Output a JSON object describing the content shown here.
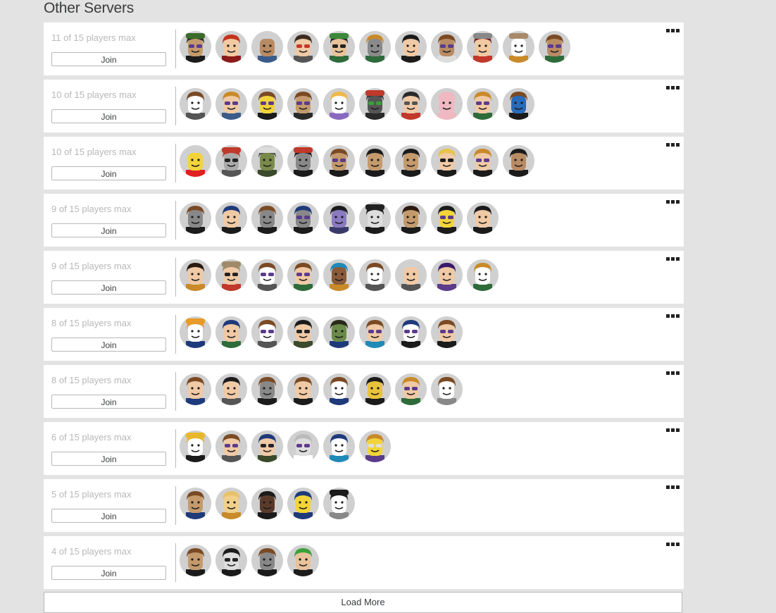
{
  "section": {
    "title": "Other Servers"
  },
  "join_label": "Join",
  "load_more_label": "Load More",
  "servers": [
    {
      "players_text": "11 of 15 players max",
      "avatars": [
        {
          "skin": "#c49a6c",
          "hair": "#2a2a2a",
          "shirt": "#1b1b1b",
          "hat": "#3a6b2a",
          "glasses": "#5b3b8a"
        },
        {
          "skin": "#f2c9a0",
          "hair": "#c2331f",
          "shirt": "#8b1a1a",
          "hat": "",
          "glasses": ""
        },
        {
          "skin": "#b98b64",
          "hair": "",
          "shirt": "#3b5b8a",
          "hat": "",
          "glasses": ""
        },
        {
          "skin": "#f0c9a5",
          "hair": "#3b2a1e",
          "shirt": "#555555",
          "hat": "",
          "glasses": "#c0392b"
        },
        {
          "skin": "#e8c29a",
          "hair": "#2a2a2a",
          "shirt": "#2e6b3a",
          "hat": "#3a8a3a",
          "glasses": "#222222"
        },
        {
          "skin": "#8a8a8a",
          "hair": "#c98a2a",
          "shirt": "#2e6b3a",
          "hat": "",
          "glasses": ""
        },
        {
          "skin": "#f0c9a5",
          "hair": "#1b1b1b",
          "shirt": "#1b1b1b",
          "hat": "",
          "glasses": ""
        },
        {
          "skin": "#b98b64",
          "hair": "#7a4a24",
          "shirt": "#dddddd",
          "hat": "",
          "glasses": "#5b3b8a"
        },
        {
          "skin": "#f2c9a0",
          "hair": "#7a1a1a",
          "shirt": "#c0392b",
          "hat": "#888888",
          "glasses": ""
        },
        {
          "skin": "#ffffff",
          "hair": "",
          "shirt": "#c98a2a",
          "hat": "#a88a6a",
          "glasses": ""
        },
        {
          "skin": "#b98b64",
          "hair": "#7a4a24",
          "shirt": "#2e6b3a",
          "hat": "",
          "glasses": "#5b3b8a"
        }
      ]
    },
    {
      "players_text": "10 of 15 players max",
      "avatars": [
        {
          "skin": "#ffffff",
          "hair": "#7a4a24",
          "shirt": "#555555",
          "hat": "",
          "glasses": ""
        },
        {
          "skin": "#f0c9a5",
          "hair": "#c98a2a",
          "shirt": "#3b5b8a",
          "hat": "",
          "glasses": "#5b3b8a"
        },
        {
          "skin": "#f2d43a",
          "hair": "#7a4a24",
          "shirt": "#1b1b1b",
          "hat": "",
          "glasses": "#5b3b8a"
        },
        {
          "skin": "#c49a6c",
          "hair": "#7a4a24",
          "shirt": "#2a2a2a",
          "hat": "",
          "glasses": "#5b3b8a"
        },
        {
          "skin": "#ffffff",
          "hair": "#f0b84a",
          "shirt": "#8a6ac0",
          "hat": "",
          "glasses": ""
        },
        {
          "skin": "#555555",
          "hair": "#3a3a3a",
          "shirt": "#2a2a2a",
          "hat": "#c0392b",
          "glasses": "#3aa03a"
        },
        {
          "skin": "#f0c9a5",
          "hair": "#2a2a2a",
          "shirt": "#c0392b",
          "hat": "",
          "glasses": "#555555"
        },
        {
          "skin": "#f0b8c0",
          "hair": "#f0b8c0",
          "shirt": "#f0b8c0",
          "hat": "",
          "glasses": ""
        },
        {
          "skin": "#f0c9a5",
          "hair": "#c98a2a",
          "shirt": "#2e6b3a",
          "hat": "",
          "glasses": "#5b3b8a"
        },
        {
          "skin": "#2a6bb8",
          "hair": "#7a4a24",
          "shirt": "#1b1b1b",
          "hat": "",
          "glasses": ""
        }
      ]
    },
    {
      "players_text": "10 of 15 players max",
      "avatars": [
        {
          "skin": "#f2d43a",
          "hair": "",
          "shirt": "#e02020",
          "hat": "",
          "glasses": ""
        },
        {
          "skin": "#aaaaaa",
          "hair": "#c0392b",
          "shirt": "#555555",
          "hat": "#c0392b",
          "glasses": "#222222"
        },
        {
          "skin": "#7a8a4a",
          "hair": "#555555",
          "shirt": "#3a4a2a",
          "hat": "#dddddd",
          "glasses": ""
        },
        {
          "skin": "#888888",
          "hair": "#1b1b1b",
          "shirt": "#1b1b1b",
          "hat": "#c0392b",
          "glasses": ""
        },
        {
          "skin": "#c49a6c",
          "hair": "#7a4a24",
          "shirt": "#1b1b1b",
          "hat": "",
          "glasses": "#5b3b8a"
        },
        {
          "skin": "#c49a6c",
          "hair": "#1b1b1b",
          "shirt": "#1b1b1b",
          "hat": "",
          "glasses": ""
        },
        {
          "skin": "#c49a6c",
          "hair": "#1b1b1b",
          "shirt": "#1b1b1b",
          "hat": "",
          "glasses": ""
        },
        {
          "skin": "#f0c9a5",
          "hair": "#e8c24a",
          "shirt": "#1b1b1b",
          "hat": "",
          "glasses": "#1b1b1b"
        },
        {
          "skin": "#f0c9a5",
          "hair": "#c98a2a",
          "shirt": "#1b1b1b",
          "hat": "",
          "glasses": "#5b3b8a"
        },
        {
          "skin": "#b98b64",
          "hair": "#1b1b1b",
          "shirt": "#1b1b1b",
          "hat": "",
          "glasses": ""
        }
      ]
    },
    {
      "players_text": "9 of 15 players max",
      "avatars": [
        {
          "skin": "#888888",
          "hair": "#7a4a24",
          "shirt": "#1b1b1b",
          "hat": "",
          "glasses": ""
        },
        {
          "skin": "#f0c9a5",
          "hair": "#1f3a7a",
          "shirt": "#1b1b1b",
          "hat": "",
          "glasses": ""
        },
        {
          "skin": "#888888",
          "hair": "#7a4a24",
          "shirt": "#1b1b1b",
          "hat": "",
          "glasses": ""
        },
        {
          "skin": "#888888",
          "hair": "#1f3a7a",
          "shirt": "#1b1b1b",
          "hat": "",
          "glasses": "#5b3b8a"
        },
        {
          "skin": "#8a7ac0",
          "hair": "#1b1b1b",
          "shirt": "#3a3a6a",
          "hat": "",
          "glasses": ""
        },
        {
          "skin": "#dddddd",
          "hair": "#1b1b1b",
          "shirt": "#1b1b1b",
          "hat": "#222222",
          "glasses": ""
        },
        {
          "skin": "#c49a6c",
          "hair": "#2a1a10",
          "shirt": "#1b1b1b",
          "hat": "",
          "glasses": ""
        },
        {
          "skin": "#f2d43a",
          "hair": "#1b1b1b",
          "shirt": "#1b1b1b",
          "hat": "",
          "glasses": "#5b3b8a"
        },
        {
          "skin": "#f0c9a5",
          "hair": "#1b1b1b",
          "shirt": "#1b1b1b",
          "hat": "",
          "glasses": ""
        }
      ]
    },
    {
      "players_text": "9 of 15 players max",
      "avatars": [
        {
          "skin": "#f0c9a5",
          "hair": "#2a1a10",
          "shirt": "#c98a2a",
          "hat": "",
          "glasses": ""
        },
        {
          "skin": "#f0c9a5",
          "hair": "#a08a6a",
          "shirt": "#c0392b",
          "hat": "#a08a6a",
          "glasses": "#222222"
        },
        {
          "skin": "#ffffff",
          "hair": "#7a4a24",
          "shirt": "#555555",
          "hat": "",
          "glasses": "#5b3b8a"
        },
        {
          "skin": "#f0c9a5",
          "hair": "#7a4a24",
          "shirt": "#2e6b3a",
          "hat": "",
          "glasses": "#5b3b8a"
        },
        {
          "skin": "#8a5a3a",
          "hair": "#1f8ab8",
          "shirt": "#c98a2a",
          "hat": "",
          "glasses": ""
        },
        {
          "skin": "#ffffff",
          "hair": "#7a4a24",
          "shirt": "#555555",
          "hat": "",
          "glasses": ""
        },
        {
          "skin": "#f0c9a5",
          "hair": "",
          "shirt": "#555555",
          "hat": "",
          "glasses": ""
        },
        {
          "skin": "#f0c9a5",
          "hair": "#3a1a6a",
          "shirt": "#5b3b8a",
          "hat": "",
          "glasses": ""
        },
        {
          "skin": "#ffffff",
          "hair": "#c98a2a",
          "shirt": "#2e6b3a",
          "hat": "",
          "glasses": ""
        }
      ]
    },
    {
      "players_text": "8 of 15 players max",
      "avatars": [
        {
          "skin": "#ffffff",
          "hair": "#e89a2a",
          "shirt": "#1f3a7a",
          "hat": "#e89a2a",
          "glasses": ""
        },
        {
          "skin": "#f0c9a5",
          "hair": "#1f3a7a",
          "shirt": "#2e6b3a",
          "hat": "",
          "glasses": ""
        },
        {
          "skin": "#ffffff",
          "hair": "#7a4a24",
          "shirt": "#555555",
          "hat": "",
          "glasses": "#5b3b8a"
        },
        {
          "skin": "#f0c9a5",
          "hair": "#1b1b1b",
          "shirt": "#3a4a2a",
          "hat": "",
          "glasses": "#222222"
        },
        {
          "skin": "#6a8a4a",
          "hair": "#2a2a1a",
          "shirt": "#1f3a7a",
          "hat": "",
          "glasses": ""
        },
        {
          "skin": "#f0c9a5",
          "hair": "#7a4a24",
          "shirt": "#1f8ab8",
          "hat": "",
          "glasses": "#5b3b8a"
        },
        {
          "skin": "#ffffff",
          "hair": "#1f3a7a",
          "shirt": "#1b1b1b",
          "hat": "",
          "glasses": "#5b3b8a"
        },
        {
          "skin": "#f0c9a5",
          "hair": "#7a4a24",
          "shirt": "#1b1b1b",
          "hat": "",
          "glasses": "#5b3b8a"
        }
      ]
    },
    {
      "players_text": "8 of 15 players max",
      "avatars": [
        {
          "skin": "#f0c9a5",
          "hair": "#7a4a24",
          "shirt": "#1f3a7a",
          "hat": "",
          "glasses": ""
        },
        {
          "skin": "#f0c9a5",
          "hair": "#1b1b1b",
          "shirt": "#555555",
          "hat": "",
          "glasses": ""
        },
        {
          "skin": "#888888",
          "hair": "#7a4a24",
          "shirt": "#1b1b1b",
          "hat": "",
          "glasses": ""
        },
        {
          "skin": "#f0c9a5",
          "hair": "#7a4a24",
          "shirt": "#1b1b1b",
          "hat": "",
          "glasses": ""
        },
        {
          "skin": "#ffffff",
          "hair": "#7a4a24",
          "shirt": "#1f3a7a",
          "hat": "",
          "glasses": ""
        },
        {
          "skin": "#e8c23a",
          "hair": "#1b1b1b",
          "shirt": "#1b1b1b",
          "hat": "",
          "glasses": ""
        },
        {
          "skin": "#f0c9a5",
          "hair": "#c98a2a",
          "shirt": "#2e6b3a",
          "hat": "",
          "glasses": "#5b3b8a"
        },
        {
          "skin": "#ffffff",
          "hair": "#7a4a24",
          "shirt": "#888888",
          "hat": "",
          "glasses": ""
        }
      ]
    },
    {
      "players_text": "6 of 15 players max",
      "avatars": [
        {
          "skin": "#ffffff",
          "hair": "#e8b82a",
          "shirt": "#1b1b1b",
          "hat": "#e8b82a",
          "glasses": ""
        },
        {
          "skin": "#f0c9a5",
          "hair": "#7a4a24",
          "shirt": "#555555",
          "hat": "",
          "glasses": "#5b3b8a"
        },
        {
          "skin": "#f0c9a5",
          "hair": "#1f3a7a",
          "shirt": "#3a4a2a",
          "hat": "",
          "glasses": "#222222"
        },
        {
          "skin": "#dddddd",
          "hair": "#bbbbbb",
          "shirt": "#ffffff",
          "hat": "",
          "glasses": "#5b3b8a"
        },
        {
          "skin": "#ffffff",
          "hair": "#1f3a7a",
          "shirt": "#1f8ab8",
          "hat": "",
          "glasses": ""
        },
        {
          "skin": "#f2d43a",
          "hair": "#c98a2a",
          "shirt": "#5b3b8a",
          "hat": "",
          "glasses": "#e0e0e0"
        }
      ]
    },
    {
      "players_text": "5 of 15 players max",
      "avatars": [
        {
          "skin": "#c49a6c",
          "hair": "#7a4a24",
          "shirt": "#1f3a7a",
          "hat": "",
          "glasses": ""
        },
        {
          "skin": "#f0d08a",
          "hair": "#e8c26a",
          "shirt": "#c98a2a",
          "hat": "",
          "glasses": ""
        },
        {
          "skin": "#5a3a2a",
          "hair": "#1b1b1b",
          "shirt": "#1b1b1b",
          "hat": "",
          "glasses": ""
        },
        {
          "skin": "#f2d43a",
          "hair": "#1f3a7a",
          "shirt": "#1f3a7a",
          "hat": "",
          "glasses": ""
        },
        {
          "skin": "#ffffff",
          "hair": "#1b1b1b",
          "shirt": "#888888",
          "hat": "#1b1b1b",
          "glasses": ""
        }
      ]
    },
    {
      "players_text": "4 of 15 players max",
      "avatars": [
        {
          "skin": "#c49a6c",
          "hair": "#7a4a24",
          "shirt": "#1b1b1b",
          "hat": "",
          "glasses": ""
        },
        {
          "skin": "#dddddd",
          "hair": "#1b1b1b",
          "shirt": "#1b1b1b",
          "hat": "",
          "glasses": "#222222"
        },
        {
          "skin": "#888888",
          "hair": "#7a4a24",
          "shirt": "#1b1b1b",
          "hat": "",
          "glasses": ""
        },
        {
          "skin": "#e8c29a",
          "hair": "#3aa03a",
          "shirt": "#1b1b1b",
          "hat": "",
          "glasses": ""
        }
      ]
    }
  ]
}
